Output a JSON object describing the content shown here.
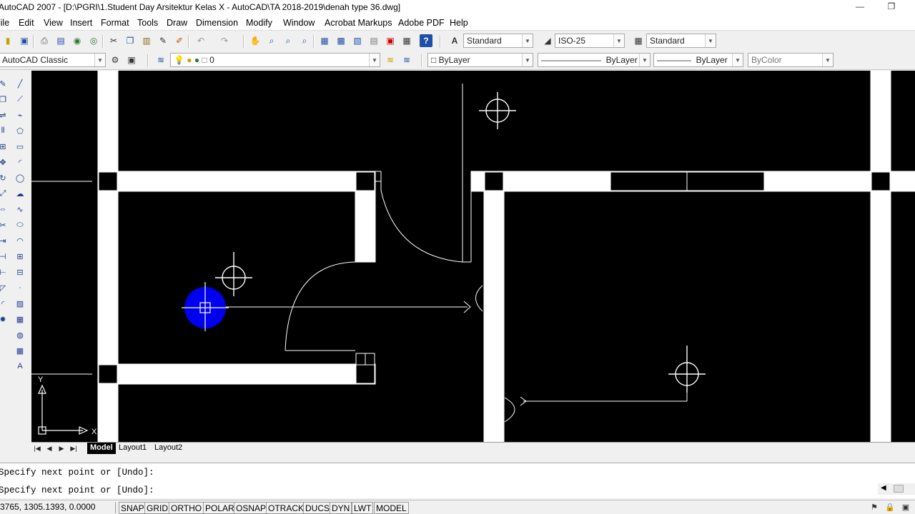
{
  "window": {
    "title": "AutoCAD 2007 - [D:\\PGRI\\1.Student Day Arsitektur Kelas X - AutoCAD\\TA 2018-2019\\denah type 36.dwg]",
    "minimize": "—",
    "restore": "❐"
  },
  "menu": [
    "File",
    "Edit",
    "View",
    "Insert",
    "Format",
    "Tools",
    "Draw",
    "Dimension",
    "Modify",
    "Window",
    "Acrobat Markups",
    "Adobe PDF",
    "Help"
  ],
  "toolbar1": {
    "text_style": "Standard",
    "dim_style": "ISO-25",
    "table_style": "Standard",
    "icons": [
      "new-icon",
      "save-icon",
      "plot-icon",
      "plot-preview-icon",
      "publish-icon",
      "3d-dwf-icon",
      "cut-icon",
      "copy-icon",
      "paste-icon",
      "match-properties-icon",
      "block-editor-icon",
      "undo-icon",
      "redo-icon",
      "pan-icon",
      "zoom-realtime-icon",
      "zoom-window-icon",
      "zoom-previous-icon",
      "properties-icon",
      "design-center-icon",
      "tool-palettes-icon",
      "sheet-set-icon",
      "markup-icon",
      "quickcalc-icon",
      "help-icon"
    ]
  },
  "toolbar2": {
    "workspace": "AutoCAD Classic",
    "layer": "0",
    "color": "ByLayer",
    "linetype": "ByLayer",
    "lineweight": "ByLayer",
    "plotstyle": "ByColor"
  },
  "draw_tools": [
    "line-icon",
    "construction-line-icon",
    "polyline-icon",
    "polygon-icon",
    "rectangle-icon",
    "arc-icon",
    "circle-icon",
    "revision-cloud-icon",
    "spline-icon",
    "ellipse-icon",
    "ellipse-arc-icon",
    "insert-block-icon",
    "make-block-icon",
    "point-icon",
    "hatch-icon",
    "gradient-icon",
    "region-icon",
    "table-icon",
    "multiline-text-icon"
  ],
  "modify_tools": [
    "erase-icon",
    "copy-object-icon",
    "mirror-icon",
    "offset-icon",
    "array-icon",
    "move-icon",
    "rotate-icon",
    "scale-icon",
    "stretch-icon",
    "trim-icon",
    "extend-icon",
    "break-icon",
    "join-icon",
    "chamfer-icon",
    "fillet-icon",
    "explode-icon"
  ],
  "tabs": {
    "model": "Model",
    "layout1": "Layout1",
    "layout2": "Layout2"
  },
  "command": {
    "history": "Specify next point or [Undo]:",
    "prompt": "Specify next point or [Undo]:"
  },
  "status": {
    "coordinates": "3765, 1305.1393, 0.0000",
    "buttons": [
      "SNAP",
      "GRID",
      "ORTHO",
      "POLAR",
      "OSNAP",
      "OTRACK",
      "DUCS",
      "DYN",
      "LWT",
      "MODEL"
    ]
  },
  "ucs": {
    "x_label": "X",
    "y_label": "Y"
  },
  "colors": {
    "canvas": "#000000",
    "drawing": "#ffffff",
    "cursor_highlight": "#0000ee",
    "active_tab_bg": "#000000"
  }
}
